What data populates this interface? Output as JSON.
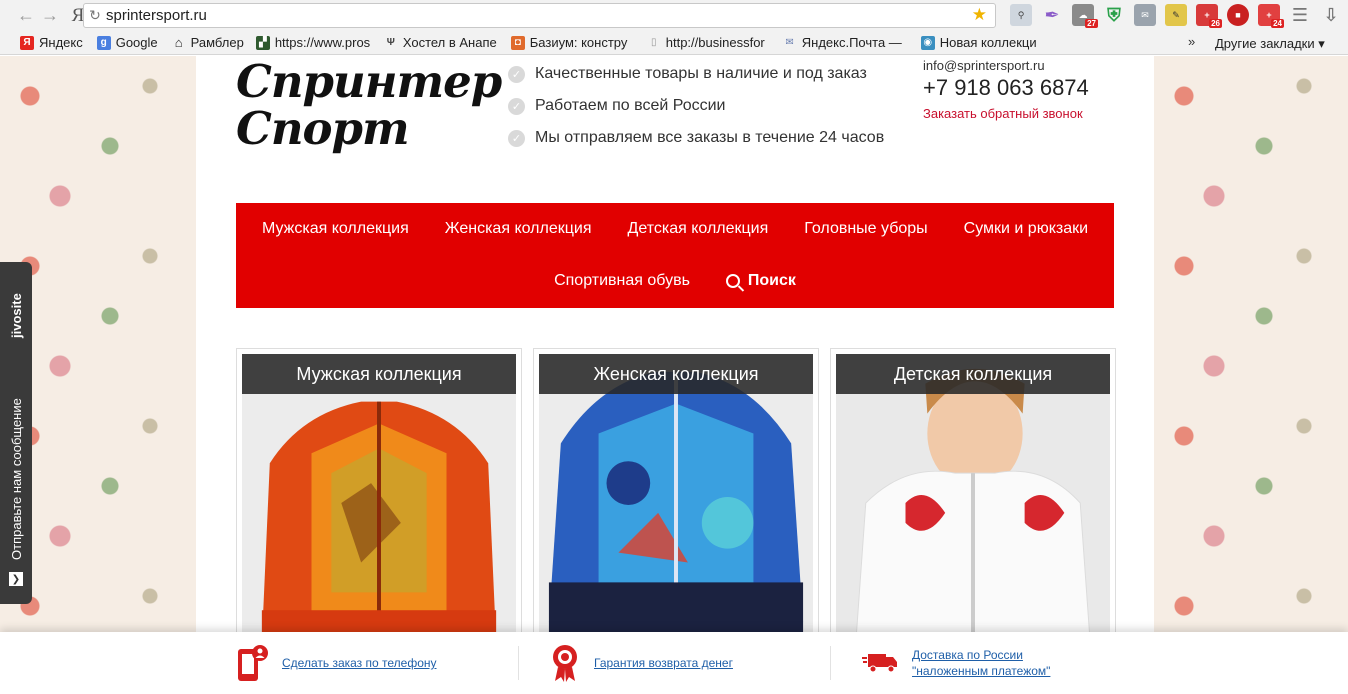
{
  "browser": {
    "back_icon": "back-arrow-icon",
    "forward_icon": "forward-arrow-icon",
    "yandex_glyph": "Я",
    "url": "sprintersport.ru",
    "bookmarks": [
      {
        "label": "Яндекс",
        "icon_color": "#e52620",
        "icon_char": "Я"
      },
      {
        "label": "Google",
        "icon_color": "#4a7fe0",
        "icon_char": "g"
      },
      {
        "label": "Рамблер",
        "icon_color": "#222222",
        "icon_char": "⌂"
      },
      {
        "label": "https://www.pros",
        "icon_color": "#2f5a2f",
        "icon_char": "▞"
      },
      {
        "label": "Хостел в Анапе",
        "icon_color": "#444444",
        "icon_char": "Ψ"
      },
      {
        "label": "Базиум: констру",
        "icon_color": "#e06a2c",
        "icon_char": "◘"
      },
      {
        "label": "http://businessfor",
        "icon_color": "#aaaaaa",
        "icon_char": "▯"
      },
      {
        "label": "Яндекс.Почта —",
        "icon_color": "#6a7fb0",
        "icon_char": "✉"
      },
      {
        "label": "Новая коллекци",
        "icon_color": "#3a8fc0",
        "icon_char": "◉"
      }
    ],
    "more_bookmarks": "»",
    "other_bookmarks": "Другие закладки ▾",
    "ext_badges": [
      "27",
      "26",
      "24"
    ]
  },
  "header": {
    "logo_line1": "Спринтер",
    "logo_line2": "Спорт",
    "features": [
      "Качественные товары в наличие и под заказ",
      "Работаем по всей России",
      "Мы отправляем все заказы в течение 24 часов"
    ],
    "email": "info@sprintersport.ru",
    "phone": "+7 918 063 6874",
    "callback": "Заказать обратный звонок"
  },
  "menu": {
    "row1": [
      "Мужская коллекция",
      "Женская коллекция",
      "Детская коллекция",
      "Головные уборы",
      "Сумки и рюкзаки"
    ],
    "row2": [
      "Спортивная обувь"
    ],
    "search": "Поиск"
  },
  "cards": [
    {
      "title": "Мужская коллекция"
    },
    {
      "title": "Женская коллекция"
    },
    {
      "title": "Детская коллекция"
    }
  ],
  "bottom": {
    "order_phone": "Сделать заказ по телефону",
    "guarantee": "Гарантия возврата денег",
    "delivery_line1": "Доставка по России",
    "delivery_line2": "\"наложенным платежом\""
  },
  "widget": {
    "brand": "jivosite",
    "cta": "Отправьте нам сообщение"
  },
  "colors": {
    "brand_red": "#e10000",
    "link_blue": "#1f5fa8",
    "callback_red": "#c8102e"
  }
}
